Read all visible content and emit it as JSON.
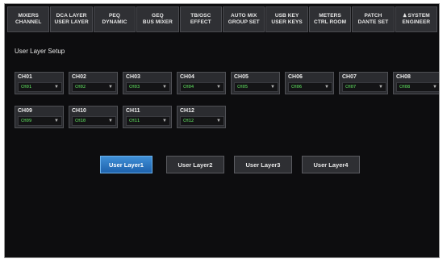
{
  "tabs": [
    {
      "line1": "MIXERS",
      "line2": "CHANNEL"
    },
    {
      "line1": "DCA LAYER",
      "line2": "USER LAYER"
    },
    {
      "line1": "PEQ",
      "line2": "DYNAMIC"
    },
    {
      "line1": "GEQ",
      "line2": "BUS MIXER"
    },
    {
      "line1": "TB/OSC",
      "line2": "EFFECT"
    },
    {
      "line1": "AUTO MIX",
      "line2": "GROUP SET"
    },
    {
      "line1": "USB KEY",
      "line2": "USER KEYS"
    },
    {
      "line1": "METERS",
      "line2": "CTRL ROOM"
    },
    {
      "line1": "PATCH",
      "line2": "DANTE SET"
    },
    {
      "line1": "SYSTEM",
      "line2": "ENGINEER",
      "icon": "person-icon"
    }
  ],
  "page": {
    "title": "User Layer Setup"
  },
  "channels": [
    {
      "label": "CH01",
      "value": "CH01"
    },
    {
      "label": "CH02",
      "value": "CH02"
    },
    {
      "label": "CH03",
      "value": "CH03"
    },
    {
      "label": "CH04",
      "value": "CH04"
    },
    {
      "label": "CH05",
      "value": "CH05"
    },
    {
      "label": "CH06",
      "value": "CH06"
    },
    {
      "label": "CH07",
      "value": "CH07"
    },
    {
      "label": "CH08",
      "value": "CH08"
    },
    {
      "label": "CH09",
      "value": "CH09"
    },
    {
      "label": "CH10",
      "value": "CH10"
    },
    {
      "label": "CH11",
      "value": "CH11"
    },
    {
      "label": "CH12",
      "value": "CH12"
    }
  ],
  "layers": [
    {
      "label": "User Layer1",
      "active": true
    },
    {
      "label": "User Layer2",
      "active": false
    },
    {
      "label": "User Layer3",
      "active": false
    },
    {
      "label": "User Layer4",
      "active": false
    }
  ],
  "colors": {
    "accent": "#2f7fd0",
    "value_text": "#5fe25f",
    "background": "#0d0d0f"
  }
}
